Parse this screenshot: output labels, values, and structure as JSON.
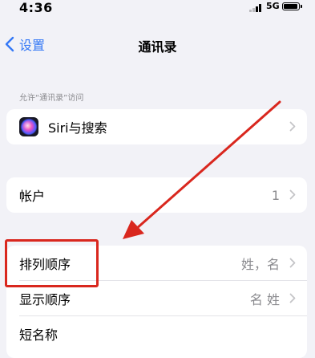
{
  "status_bar": {
    "time": "4:36",
    "network": "5G"
  },
  "nav": {
    "back_label": "设置",
    "title": "通讯录"
  },
  "section_header": "允许“通讯录”访问",
  "siri_row": {
    "label": "Siri与搜索"
  },
  "accounts_row": {
    "label": "帐户",
    "value": "1"
  },
  "sort_rows": [
    {
      "label": "排列顺序",
      "value": "姓，名"
    },
    {
      "label": "显示顺序",
      "value": "名 姓"
    },
    {
      "label": "短名称"
    }
  ],
  "icons": {
    "back": "chevron-left-icon",
    "row": "chevron-right-icon",
    "siri": "siri-icon",
    "signal": "signal-icon",
    "battery": "battery-icon"
  },
  "colors": {
    "accent": "#3478f6",
    "highlight_annotation": "#d9271e",
    "background": "#f2f2f7",
    "secondary_text": "#8a8a8e"
  }
}
